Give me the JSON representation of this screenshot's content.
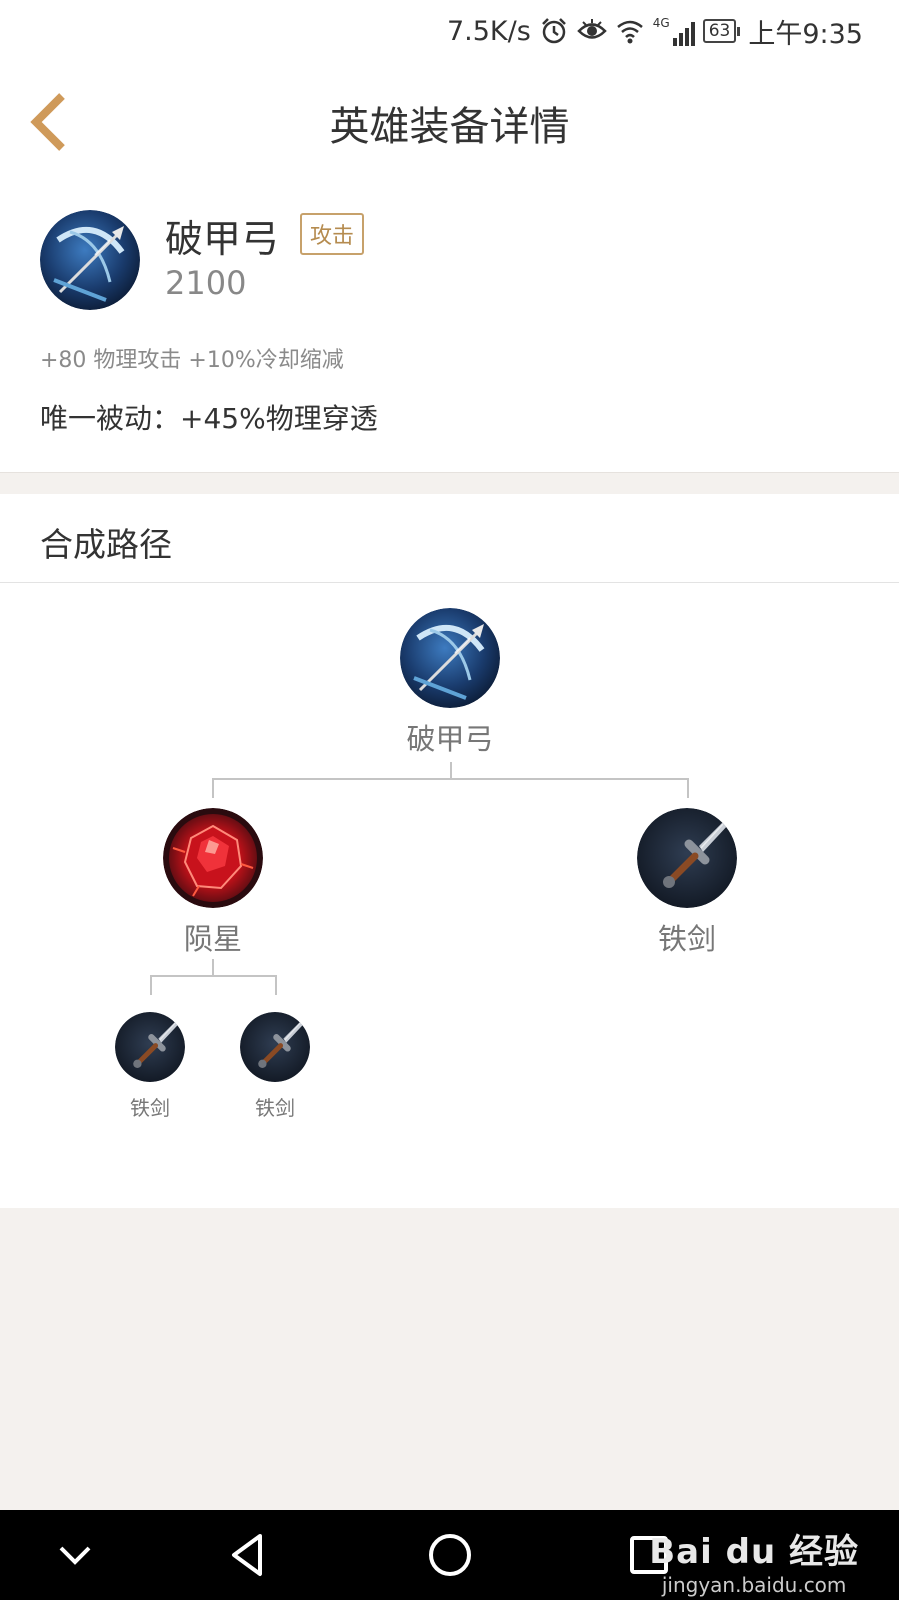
{
  "status_bar": {
    "speed": "7.5K/s",
    "network": "4G",
    "battery": "63",
    "time": "上午9:35"
  },
  "header": {
    "title": "英雄装备详情",
    "back_icon": "chevron-left-icon",
    "accent": "#c7a16b"
  },
  "item": {
    "name": "破甲弓",
    "tag": "攻击",
    "price": "2100",
    "stats": "+80 物理攻击 +10%冷却缩减",
    "passive": "唯一被动：+45%物理穿透",
    "icon": "armor-piercing-bow-icon"
  },
  "recipe": {
    "title": "合成路径",
    "root": {
      "name": "破甲弓",
      "icon": "armor-piercing-bow-icon"
    },
    "children": [
      {
        "name": "陨星",
        "icon": "meteor-gem-icon",
        "children": [
          {
            "name": "铁剑",
            "icon": "iron-sword-icon"
          },
          {
            "name": "铁剑",
            "icon": "iron-sword-icon"
          }
        ]
      },
      {
        "name": "铁剑",
        "icon": "iron-sword-icon"
      }
    ]
  },
  "nav_bar": {
    "buttons": [
      "hide-keyboard-icon",
      "back-triangle-icon",
      "home-circle-icon",
      "recents-square-icon"
    ]
  },
  "watermark": {
    "brand": "Bai du 经验",
    "url": "jingyan.baidu.com"
  }
}
